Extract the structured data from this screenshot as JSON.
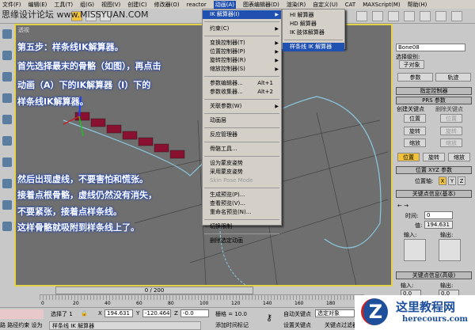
{
  "menubar": [
    "文件(F)",
    "编辑(E)",
    "工具(T)",
    "组(G)",
    "视图(V)",
    "创建(C)",
    "修改器(O)",
    "reactor",
    "动画(A)",
    "图表编辑器(D)",
    "渲染(R)",
    "自定义(U)",
    "CAT",
    "MAXScript(M)",
    "帮助(H)"
  ],
  "watermark": "思缘设计论坛 www.MISSYUAN.COM",
  "viewport": {
    "label": "透视",
    "notes": [
      "第五步：样条线IK解算器。",
      "首先选择最末的骨骼（如图），再点击",
      "动画（A）下的IK解算器（I）下的",
      "样条线IK解算器。"
    ],
    "notes2": [
      "然后出现虚线，不要害怕和慌张。",
      "接着点根骨骼，虚线仍然没有消失，",
      "不要紧张，接着点样条线。",
      "这样骨骼就吸附到样条线上了。"
    ]
  },
  "anim_menu": {
    "ik": "IK 解算器(I)",
    "constraints": "约束(C)",
    "transform_ctrl": "变换控制器(T)",
    "position_ctrl": "位置控制器(P)",
    "rotation_ctrl": "旋转控制器(R)",
    "scale_ctrl": "缩放控制器(S)",
    "param_editor": "参数编辑器...",
    "param_editor_sc": "Alt+1",
    "param_collector": "参数收集器...",
    "param_collector_sc": "Alt+2",
    "wire_params": "关联参数(W)",
    "anim_layers": "动画层",
    "reaction_mgr": "反应管理器",
    "bone_tools": "骨骼工具...",
    "set_skin_pose": "设为蒙皮姿势",
    "assume_skin_pose": "采用蒙皮姿势",
    "skin_pose_mode": "Skin Pose Mode",
    "make_preview": "生成预览(P)...",
    "view_preview": "查看预览(V)...",
    "rename_preview": "重命名预览(N)...",
    "toggle_limits": "切换限制",
    "delete_anim": "删除选定动画"
  },
  "ik_submenu": [
    "HI 解算器",
    "HD 解算器",
    "IK 肢体解算器",
    "样条线 IK 解算器"
  ],
  "panel": {
    "object_name": "Bone08",
    "sel_level": "选择级别:",
    "sub_object": "子对象",
    "tab_params": "参数",
    "tab_track": "轨迹",
    "assign_ctrl": "指定控制器",
    "prs_params": "PRS 参数",
    "create_key": "创建关键点",
    "delete_key": "删除关键点",
    "pos": "位置",
    "rot": "旋转",
    "scale": "缩放",
    "pos_xyz": "位置 XYZ 参数",
    "pos_axis": "位置轴:",
    "x": "X",
    "y": "Y",
    "z": "Z",
    "key_info_basic": "关键点信息(基本)",
    "time": "时间:",
    "time_val": "0",
    "value": "值:",
    "value_val": "194.631",
    "in": "输入:",
    "out": "输出:",
    "key_info_adv": "关键点信息(高级)",
    "in_val": "0.0",
    "out_val": "0.0"
  },
  "timeline": {
    "frame": "0 / 200",
    "ticks": [
      "0",
      "20",
      "40",
      "60",
      "80",
      "100",
      "120",
      "140",
      "160",
      "180"
    ]
  },
  "status": {
    "selected": "选择了 1",
    "x_label": "X",
    "x": "194.631",
    "y_label": "Y",
    "y": "-120.464",
    "z_label": "Z",
    "z": "-0.0",
    "grid": "栅格 = 10.0",
    "prompt": "样条线 IK 解算器",
    "add_time_tag": "添加时间标记",
    "auto_key": "自动关键点",
    "set_key": "设置关键点",
    "sel_obj": "选定对象",
    "key_filter": "关键点过滤器",
    "left_text": "路 路径约束 设为"
  },
  "logo": {
    "name": "这里教程网",
    "url": "herecours.com"
  }
}
